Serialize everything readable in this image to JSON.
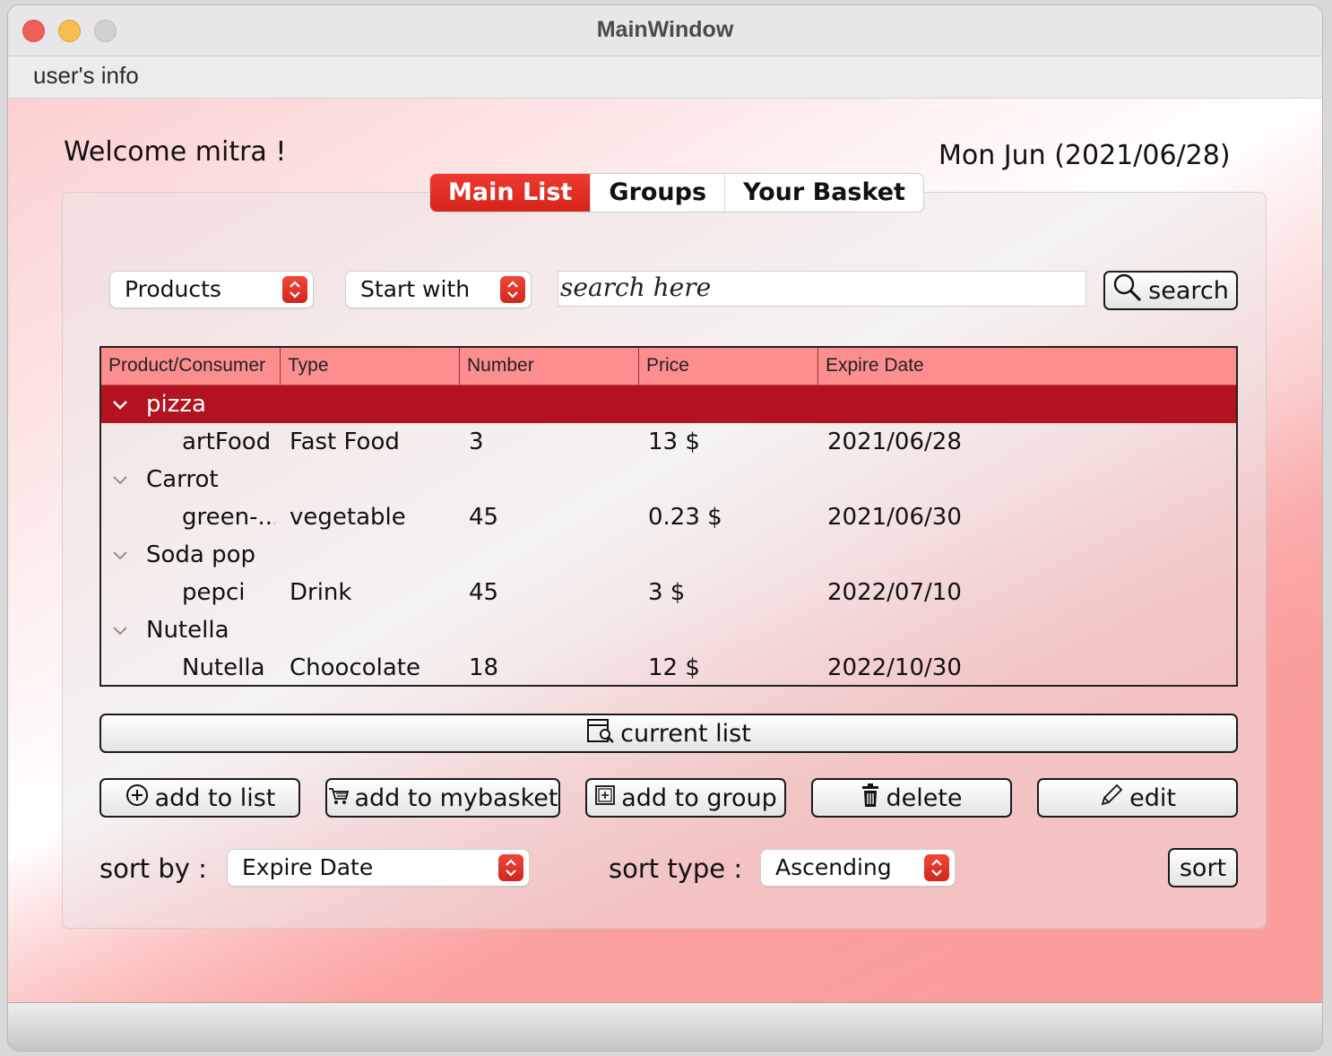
{
  "window": {
    "title": "MainWindow"
  },
  "menu": {
    "users_info": "user's info"
  },
  "header": {
    "welcome": "Welcome mitra !",
    "date": "Mon Jun (2021/06/28)"
  },
  "tabs": [
    {
      "label": "Main List",
      "active": true
    },
    {
      "label": "Groups",
      "active": false
    },
    {
      "label": "Your Basket",
      "active": false
    }
  ],
  "filters": {
    "category_value": "Products",
    "match_value": "Start with",
    "search_value": "search here",
    "search_button": "search"
  },
  "table": {
    "columns": [
      "Product/Consumer",
      "Type",
      "Number",
      "Price",
      "Expire Date"
    ],
    "groups": [
      {
        "name": "pizza",
        "selected": true,
        "item": {
          "name": "artFood",
          "type": "Fast Food",
          "number": "3",
          "price": "13 $",
          "expire": "2021/06/28"
        }
      },
      {
        "name": "Carrot",
        "selected": false,
        "item": {
          "name": "green-...",
          "type": "vegetable",
          "number": "45",
          "price": "0.23 $",
          "expire": "2021/06/30"
        }
      },
      {
        "name": "Soda pop",
        "selected": false,
        "item": {
          "name": "pepci",
          "type": "Drink",
          "number": "45",
          "price": "3 $",
          "expire": "2022/07/10"
        }
      },
      {
        "name": "Nutella",
        "selected": false,
        "item": {
          "name": "Nutella",
          "type": "Choocolate",
          "number": "18",
          "price": "12 $",
          "expire": "2022/10/30"
        }
      }
    ]
  },
  "actions": {
    "current_list": "current list",
    "add_to_list": "add to list",
    "add_to_mybasket": "add to mybasket",
    "add_to_group": "add to group",
    "delete": "delete",
    "edit": "edit"
  },
  "sorting": {
    "sort_by_label": "sort by :",
    "sort_by_value": "Expire Date",
    "sort_type_label": "sort type :",
    "sort_type_value": "Ascending",
    "sort_button": "sort"
  },
  "colors": {
    "accent": "#d6241b",
    "selected_row": "#b31220",
    "header_row": "#fc8e8e"
  }
}
